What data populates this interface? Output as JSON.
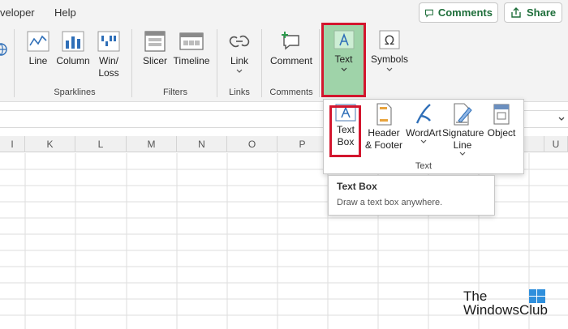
{
  "tabs": {
    "developer": "veloper",
    "help": "Help"
  },
  "header_buttons": {
    "comments": "Comments",
    "share": "Share"
  },
  "ribbon": {
    "sparklines": {
      "line": "Line",
      "column": "Column",
      "winloss_1": "Win/",
      "winloss_2": "Loss",
      "label": "Sparklines"
    },
    "filters": {
      "slicer": "Slicer",
      "timeline": "Timeline",
      "label": "Filters"
    },
    "links": {
      "link": "Link",
      "label": "Links"
    },
    "comments": {
      "comment": "Comment",
      "label": "Comments"
    },
    "text": {
      "text": "Text"
    },
    "symbols": {
      "symbols": "Symbols"
    }
  },
  "columns": [
    "I",
    "K",
    "L",
    "M",
    "N",
    "O",
    "P",
    "U"
  ],
  "dropdown": {
    "text_box_1": "Text",
    "text_box_2": "Box",
    "header_footer_1": "Header",
    "header_footer_2": "& Footer",
    "wordart": "WordArt",
    "signature_1": "Signature",
    "signature_2": "Line",
    "object": "Object",
    "group_label": "Text"
  },
  "tooltip": {
    "title": "Text Box",
    "description": "Draw a text box anywhere."
  },
  "watermark": {
    "line1": "The",
    "line2": "WindowsClub"
  },
  "colors": {
    "accent_green": "#1e6e3a",
    "highlight_green": "#9fd3a9",
    "red_outline": "#d3162e"
  }
}
